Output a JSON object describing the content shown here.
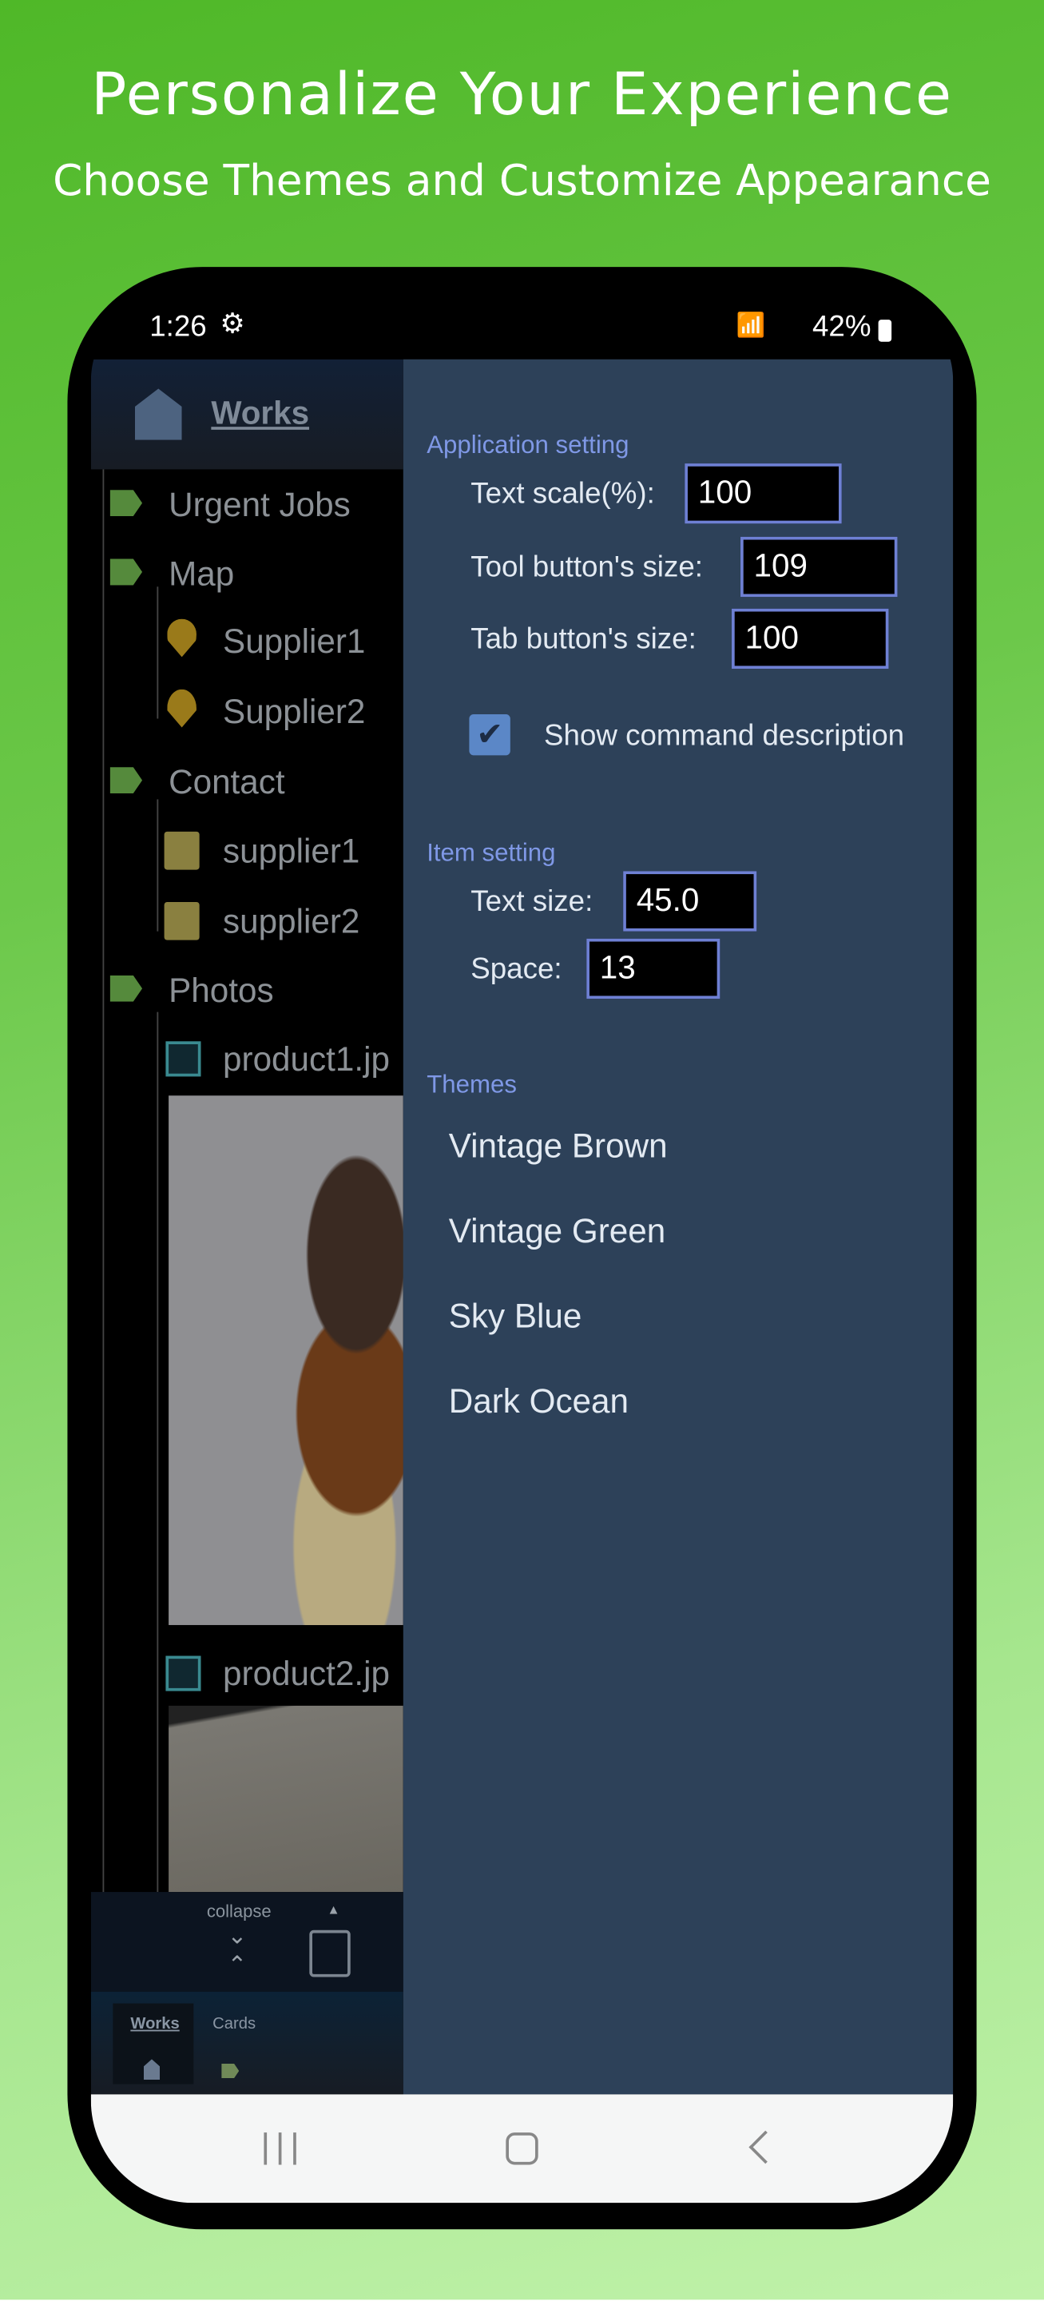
{
  "promo": {
    "title": "Personalize Your Experience",
    "subtitle": "Choose Themes and Customize Appearance"
  },
  "status_bar": {
    "time": "1:26",
    "battery": "42%",
    "icons": [
      "settings-gear-icon",
      "wifi-icon",
      "signal-icon",
      "battery-charging-icon"
    ]
  },
  "left_panel": {
    "header": {
      "title": "Works",
      "icon": "house-icon"
    },
    "tree": [
      {
        "label": "Urgent Jobs",
        "icon": "tag-icon"
      },
      {
        "label": "Map",
        "icon": "tag-icon"
      },
      {
        "label": "Supplier1",
        "icon": "map-pin-icon"
      },
      {
        "label": "Supplier2",
        "icon": "map-pin-icon"
      },
      {
        "label": "Contact",
        "icon": "tag-icon"
      },
      {
        "label": "supplier1",
        "icon": "note-icon"
      },
      {
        "label": "supplier2",
        "icon": "note-icon"
      },
      {
        "label": "Photos",
        "icon": "tag-icon"
      },
      {
        "label": "product1.jp",
        "icon": "image-icon"
      },
      {
        "label": "product2.jp",
        "icon": "image-icon"
      }
    ],
    "toolbar": {
      "collapse_label": "collapse"
    },
    "tabs": [
      {
        "label": "Works",
        "active": true
      },
      {
        "label": "Cards",
        "active": false
      }
    ]
  },
  "settings": {
    "application_section": "Application setting",
    "text_scale": {
      "label": "Text scale(%):",
      "value": "100"
    },
    "tool_button_size": {
      "label": "Tool button's size:",
      "value": "109"
    },
    "tab_button_size": {
      "label": "Tab button's size:",
      "value": "100"
    },
    "show_command_description": {
      "label": "Show command description",
      "checked": true
    },
    "item_section": "Item setting",
    "text_size": {
      "label": "Text size:",
      "value": "45.0"
    },
    "space": {
      "label": "Space:",
      "value": "13"
    },
    "themes_section": "Themes",
    "themes": [
      "Vintage Brown",
      "Vintage Green",
      "Sky Blue",
      "Dark Ocean"
    ]
  },
  "colors": {
    "panel": "#2d4159",
    "section": "#7f98e6",
    "input_border": "#6e80d4",
    "checkbox": "#5b87c7",
    "background": "#5fbf38"
  }
}
